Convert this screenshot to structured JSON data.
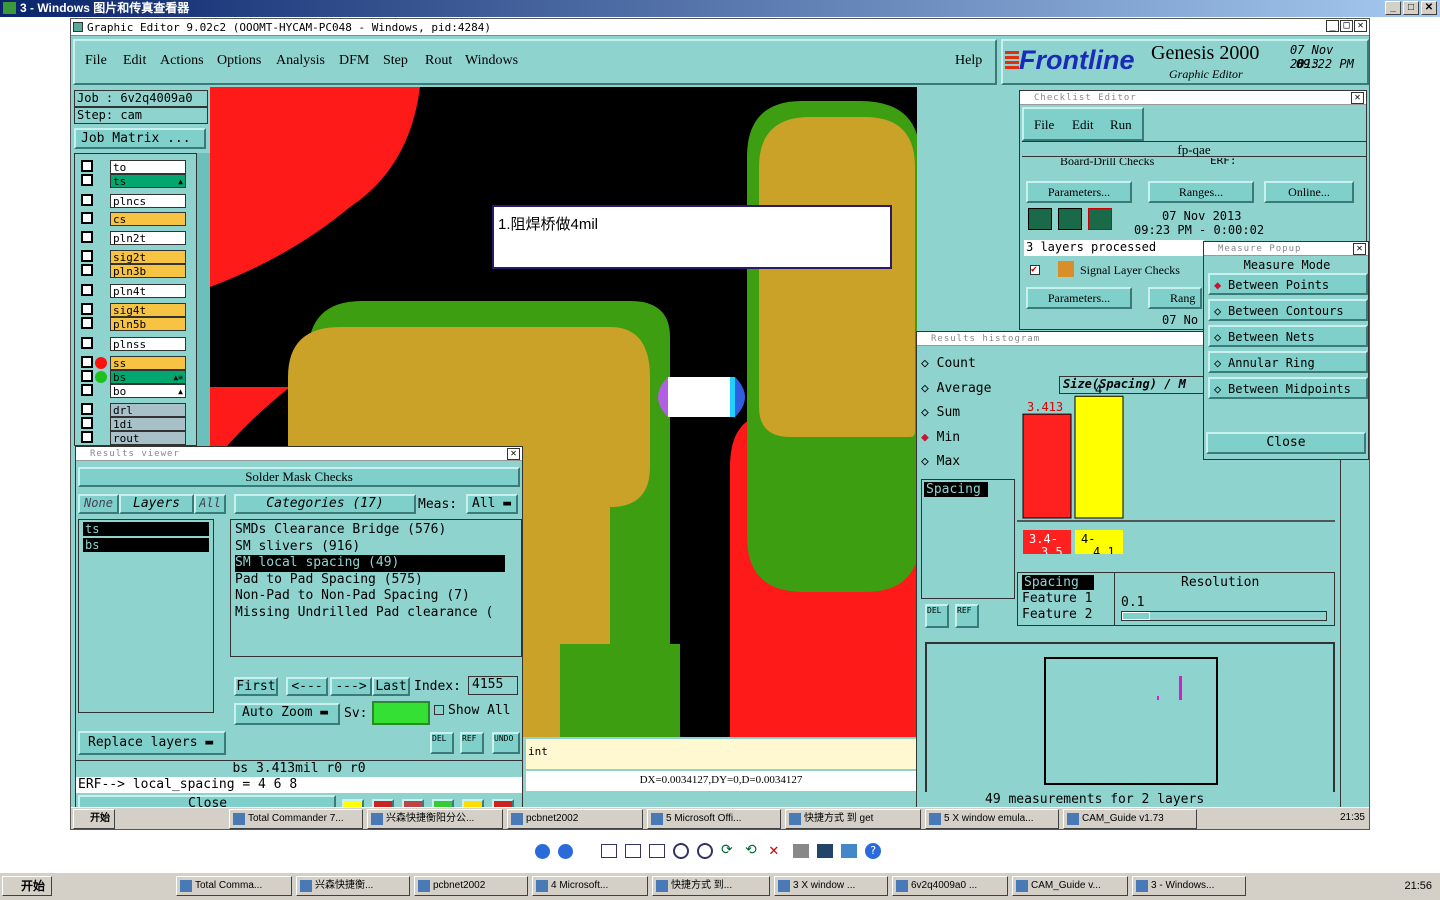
{
  "viewer": {
    "title": "3 - Windows 图片和传真查看器"
  },
  "genesis": {
    "title": "Graphic Editor 9.02c2  (OOOMT-HYCAM-PC048 - Windows, pid:4284)",
    "menu": [
      "File",
      "Edit",
      "Actions",
      "Options",
      "Analysis",
      "DFM",
      "Step",
      "Rout",
      "Windows"
    ],
    "help": "Help",
    "brand": {
      "logo": "Frontline",
      "product": "Genesis 2000",
      "subtitle": "Graphic Editor",
      "date": "07 Nov 2013",
      "time": "09:22 PM"
    }
  },
  "job": {
    "job_label": "Job : 6v2q4009a0",
    "step_label": "Step: cam",
    "matrix_button": "Job Matrix ..."
  },
  "layers": [
    {
      "name": "to",
      "color": "#ffffff",
      "tag": ""
    },
    {
      "name": "ts",
      "color": "#00a870",
      "tag": "▲"
    },
    {
      "name": "plncs",
      "color": "#ffffff",
      "tag": ""
    },
    {
      "name": "cs",
      "color": "#f6c343",
      "tag": ""
    },
    {
      "name": "pln2t",
      "color": "#ffffff",
      "tag": ""
    },
    {
      "name": "sig2t",
      "color": "#f6c343",
      "tag": ""
    },
    {
      "name": "pln3b",
      "color": "#f6c343",
      "tag": ""
    },
    {
      "name": "pln4t",
      "color": "#ffffff",
      "tag": ""
    },
    {
      "name": "sig4t",
      "color": "#f6c343",
      "tag": ""
    },
    {
      "name": "pln5b",
      "color": "#f6c343",
      "tag": ""
    },
    {
      "name": "plnss",
      "color": "#ffffff",
      "tag": ""
    },
    {
      "name": "ss",
      "color": "#f6c343",
      "tag": ""
    },
    {
      "name": "bs",
      "color": "#00a870",
      "tag": "▲≡"
    },
    {
      "name": "bo",
      "color": "#ffffff",
      "tag": "▲"
    },
    {
      "name": "drl",
      "color": "#a8c0c8",
      "tag": ""
    },
    {
      "name": "1di",
      "color": "#a8c0c8",
      "tag": ""
    },
    {
      "name": "rout",
      "color": "#a8c0c8",
      "tag": ""
    }
  ],
  "canvas": {
    "annotation": "1.阻焊桥做4mil",
    "colors": {
      "red": "#ff1a1a",
      "gold": "#c9a227",
      "green": "#3d9e12",
      "black": "#000000"
    }
  },
  "results_viewer": {
    "title": "Results viewer",
    "heading": "Solder Mask Checks",
    "none": "None",
    "layers": "Layers",
    "all": "All",
    "categories": "Categories (17)",
    "meas_label": "Meas:",
    "meas_value": "All",
    "layer_list": [
      "ts",
      "bs"
    ],
    "category_list": [
      "SMDs Clearance Bridge (576)",
      "SM slivers (916)",
      "SM local spacing (49)",
      "Pad to Pad Spacing (575)",
      "Non-Pad to Non-Pad Spacing (7)",
      "Missing Undrilled Pad clearance ("
    ],
    "selected_category": 2,
    "nav": {
      "first": "First",
      "prev": "<---",
      "next": "--->",
      "last": "Last",
      "index_label": "Index:",
      "index_value": "4155"
    },
    "auto_zoom": "Auto Zoom",
    "sv_label": "Sv:",
    "show_all": "Show All",
    "replace_layers": "Replace layers",
    "status": "bs 3.413mil  r0  r0",
    "erf": "ERF--> local_spacing = 4 6 8",
    "close": "Close",
    "int_label": "int"
  },
  "coord_bar": "DX=0.0034127,DY=0,D=0.0034127",
  "checklist": {
    "title": "Checklist Editor",
    "menu": [
      "File",
      "Edit",
      "Run"
    ],
    "name": "fp-qae",
    "row1": "Board-Drill Checks",
    "erf": "ERF:",
    "params": "Parameters...",
    "ranges": "Ranges...",
    "online": "Online...",
    "date": "07 Nov 2013",
    "time_line": "09:23 PM - 0:00:02",
    "processed": "3 layers processed",
    "row2": "Signal Layer Checks",
    "ranges_short": "Rang",
    "date_short": "07 No"
  },
  "histogram": {
    "title": "Results histogram",
    "options": [
      "Count",
      "Average",
      "Sum",
      "Min",
      "Max"
    ],
    "selected_option": 3,
    "list_item": "Spacing",
    "chart_title": "Size(Spacing) / M",
    "bottom": {
      "s1": "Spacing",
      "s2": "Feature 1",
      "s3": "Feature 2",
      "resolution": "Resolution",
      "res_value": "0.1"
    },
    "footer": "49 measurements for 2 layers"
  },
  "chart_data": {
    "type": "bar",
    "title": "Size(Spacing) / M",
    "categories": [
      "3.4-3.5",
      "4-4.1"
    ],
    "values": [
      3.413,
      4
    ],
    "data_labels": [
      "3.413",
      "4"
    ],
    "colors": [
      "#ff2020",
      "#ffff00"
    ]
  },
  "measure": {
    "title": "Measure Popup",
    "mode_label": "Measure Mode",
    "modes": [
      "Between Points",
      "Between Contours",
      "Between Nets",
      "Annular Ring",
      "Between Midpoints"
    ],
    "selected": 0,
    "close": "Close"
  },
  "inner_taskbar": {
    "start": "开始",
    "items": [
      "Total Commander 7...",
      "兴森快捷衡阳分公...",
      "pcbnet2002",
      "5 Microsoft Offi...",
      "快捷方式 到 get",
      "5 X window emula...",
      "CAM_Guide v1.73"
    ],
    "clock": "21:35"
  },
  "outer_taskbar": {
    "start": "开始",
    "items": [
      "Total Comma...",
      "兴森快捷衡...",
      "pcbnet2002",
      "4 Microsoft...",
      "快捷方式 到...",
      "3 X window ...",
      "6v2q4009a0 ...",
      "CAM_Guide v...",
      "3 - Windows..."
    ],
    "clock": "21:56"
  }
}
